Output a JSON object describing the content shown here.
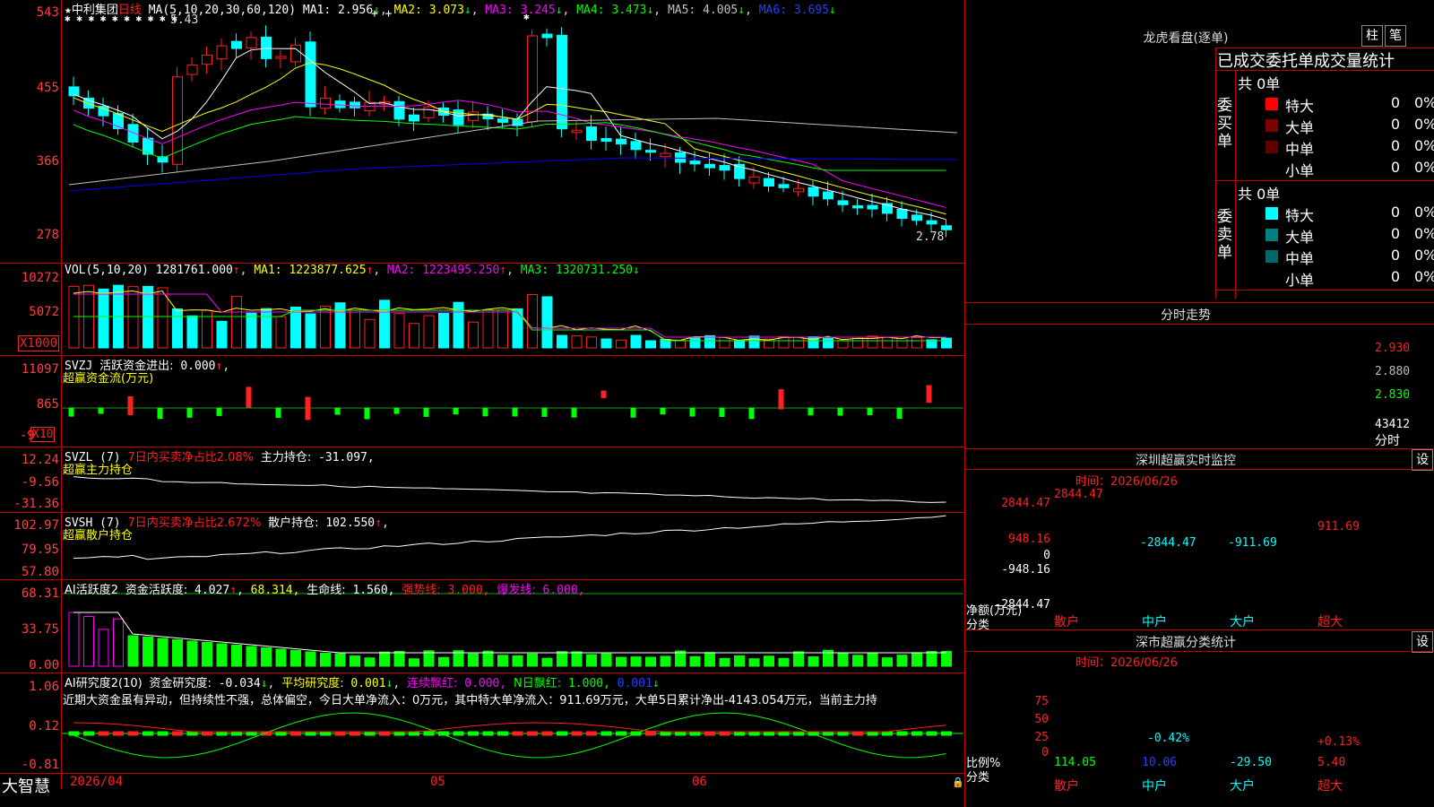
{
  "colors": {
    "up": "#ff2020",
    "down": "#00ffff",
    "ma1": "#ffffff",
    "ma2": "#ffff00",
    "ma3": "#ff00ff",
    "ma4": "#00ff00",
    "ma5": "#c0c0c0",
    "ma6": "#0000ff",
    "frame": "#c00000",
    "green": "#00ff00",
    "magenta": "#ff00ff"
  },
  "kline": {
    "indicator": "MA(5,10,20,30,60,120)",
    "stock": "中利集团",
    "period": "日线",
    "ma1_label": "MA1:",
    "ma1_value": "2.956",
    "ma2_label": "MA2:",
    "ma2_value": "3.073",
    "ma3_label": "MA3:",
    "ma3_value": "3.245",
    "ma4_label": "MA4:",
    "ma4_value": "3.473",
    "ma5_label": "MA5:",
    "ma5_value": "4.005",
    "ma6_label": "MA6:",
    "ma6_value": "3.695",
    "high_marker": "5.43",
    "low_marker": "2.78",
    "axis": [
      "543",
      "455",
      "366",
      "278"
    ],
    "star_glyph": "★",
    "stars": "✱ ✱ ✱ ✱ ✱ ✱ ✱ ✱ ✱ ✱",
    "plus_marks": "+ +",
    "top_star": "✱"
  },
  "vol": {
    "indicator": "VOL(5,10,20)",
    "value": "1281761.000",
    "ma1_label": "MA1:",
    "ma1": "1223877.625",
    "ma2_label": "MA2:",
    "ma2": "1223495.250",
    "ma3_label": "MA3:",
    "ma3": "1320731.250",
    "axis": [
      "10272",
      "5072"
    ],
    "unit": "X1000"
  },
  "svzj": {
    "indicator": "SVZJ",
    "title": "活跃资金进出:",
    "value": "0.000",
    "sub": "超赢资金流(万元)",
    "axis": [
      "11097",
      "865",
      "-9"
    ],
    "unit": "X10"
  },
  "svzl": {
    "indicator": "SVZL (7)",
    "ratio": "7日内买卖净占比2.08%",
    "label": "主力持仓:",
    "value": "-31.097,",
    "sub": "超赢主力持仓",
    "axis": [
      "12.24",
      "-9.56",
      "-31.36"
    ]
  },
  "svsh": {
    "indicator": "SVSH (7)",
    "ratio": "7日内买卖净占比2.672%",
    "label": "散户持仓:",
    "value": "102.550",
    "sub": "超赢散户持仓",
    "axis": [
      "102.97",
      "79.95",
      "57.80"
    ]
  },
  "ai1": {
    "indicator": "AI活跃度2",
    "l1": "资金活跃度:",
    "v1": "4.027",
    "v2": "68.314,",
    "l3": "生命线:",
    "v3": "1.560,",
    "l4": "强势线:",
    "v4": "3.000,",
    "l5": "爆发线:",
    "v5": "6.000,",
    "axis": [
      "68.31",
      "33.75",
      "0.00"
    ]
  },
  "ai2": {
    "indicator": "AI研究度2(10)",
    "l1": "资金研究度:",
    "v1": "-0.034",
    "l2": "平均研究度:",
    "v2": "0.001",
    "l3": "连续飘红:",
    "v3": "0.000,",
    "l4": "N日飘红:",
    "v4": "1.000,",
    "v5": "0.001",
    "text": "近期大资金虽有异动，但持续性不强，总体偏空，今日大单净流入：0万元，其中特大单净流入：911.69万元，大单5日累计净出-4143.054万元，当前主力持",
    "axis": [
      "1.06",
      "0.12",
      "-0.81"
    ]
  },
  "bottom": {
    "brand": "大智慧",
    "date": "2026/04",
    "m5": "05",
    "m6": "06"
  },
  "lhkp": {
    "title": "龙虎看盘(逐单)",
    "btn1": "柱",
    "btn2": "笔",
    "tabs": "已成交委托单成交量统计",
    "buy_side": "委买单",
    "sell_side": "委卖单",
    "buy_total": "共 0单",
    "sell_total": "共 0单",
    "buy": [
      {
        "name": "特大",
        "count": "0",
        "pct": "0%"
      },
      {
        "name": "大单",
        "count": "0",
        "pct": "0%"
      },
      {
        "name": "中单",
        "count": "0",
        "pct": "0%"
      },
      {
        "name": "小单",
        "count": "0",
        "pct": "0%"
      }
    ],
    "sell": [
      {
        "name": "特大",
        "count": "0",
        "pct": "0%"
      },
      {
        "name": "大单",
        "count": "0",
        "pct": "0%"
      },
      {
        "name": "中单",
        "count": "0",
        "pct": "0%"
      },
      {
        "name": "小单",
        "count": "0",
        "pct": "0%"
      }
    ]
  },
  "fenshi": {
    "title": "分时走势",
    "p1": "2.930",
    "p2": "2.880",
    "p3": "2.830",
    "vol": "43412",
    "label": "分时"
  },
  "szjk": {
    "title": "深圳超赢实时监控",
    "btn": "设",
    "time": "时间：2026/06/26",
    "axis": [
      "2844.47",
      "948.16",
      "0",
      "-948.16",
      "-2844.47"
    ],
    "ylabel1": "净额(万元)",
    "ylabel2": "分类",
    "cats": [
      "散户",
      "中户",
      "大户",
      "超大"
    ],
    "vals": [
      "2844.47",
      "-2844.47",
      "-911.69",
      "911.69"
    ]
  },
  "fltj": {
    "title": "深市超赢分类统计",
    "btn": "设",
    "time": "时间：2026/06/26",
    "axis": [
      "75",
      "50",
      "25",
      "0"
    ],
    "ylabel1": "比例%",
    "ylabel2": "分类",
    "cats": [
      "散户",
      "中户",
      "大户",
      "超大"
    ],
    "pcts": [
      "",
      "-0.42%",
      "",
      "+0.13%"
    ],
    "vals": [
      "114.05",
      "10.06",
      "-29.50",
      "5.40"
    ]
  }
}
